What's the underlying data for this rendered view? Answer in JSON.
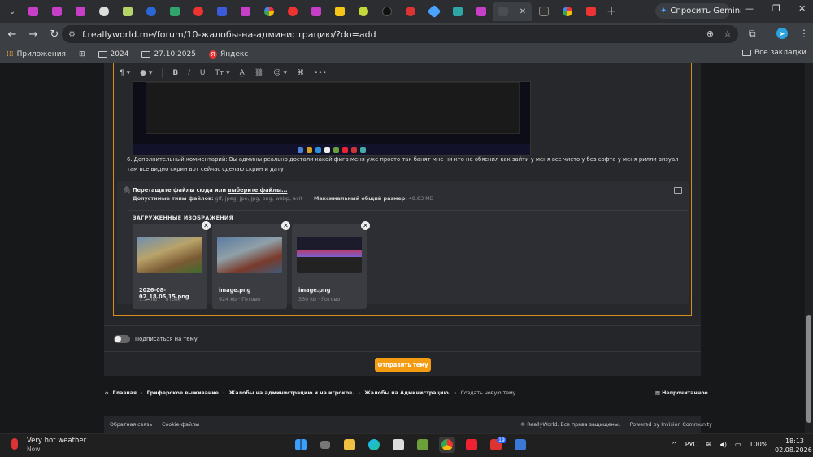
{
  "browser": {
    "url": "f.reallyworld.me/forum/10-жалобы-на-администрацию/?do=add",
    "gemini_label": "Спросить Gemini",
    "new_tab": "+",
    "tab_close": "✕"
  },
  "bookmarks": {
    "apps": "Приложения",
    "items": [
      "2024",
      "27.10.2025",
      "Яндекс"
    ],
    "all": "Все закладки"
  },
  "post": {
    "item_number": "6.",
    "item_text": "Дополнительный комментарий: Вы админы реально достали какой фига меня уже просто так банят мне ни кто не обяснил как зайти у меня все чисто у без софта у меня рилли визуал там все видно скрин вот сейчас сделаю скрин и дату"
  },
  "upload": {
    "drop_text": "Перетащите файлы сюда или",
    "choose_link": "выберите файлы...",
    "types_label": "Допустимые типы файлов:",
    "types_value": "gif, jpeg, jpe, jpg, png, webp, avif",
    "max_label": "Максимальный общий размер:",
    "max_value": "48.83 МБ",
    "images_title": "ЗАГРУЖЕННЫЕ ИЗОБРАЖЕНИЯ",
    "files": [
      {
        "name": "2026-08-02_18.05.15.png",
        "meta": "1.2 mb · Готово"
      },
      {
        "name": "image.png",
        "meta": "924 kb · Готово"
      },
      {
        "name": "image.png",
        "meta": "330 kb · Готово"
      }
    ]
  },
  "follow_label": "Подписаться на тему",
  "submit_label": "Отправить тему",
  "breadcrumbs": [
    "Главная",
    "Гриферское выживание",
    "Жалобы на администрацию и на игроков.",
    "Жалобы на Администрацию.",
    "Создать новую тему"
  ],
  "unread": "Непрочитанное",
  "footer": {
    "left": [
      "Обратная связь",
      "Cookie-файлы"
    ],
    "copyright": "© ReallyWorld. Все права защищены.",
    "powered": "Powered by Invision Community"
  },
  "taskbar": {
    "weather_title": "Very hot weather",
    "weather_sub": "Now",
    "lang": "РУС",
    "battery": "100%",
    "time": "18:13",
    "date": "02.08.2026",
    "badge": "19"
  },
  "colors": {
    "accent": "#f39c12",
    "editor_border": "#d88d1c"
  }
}
